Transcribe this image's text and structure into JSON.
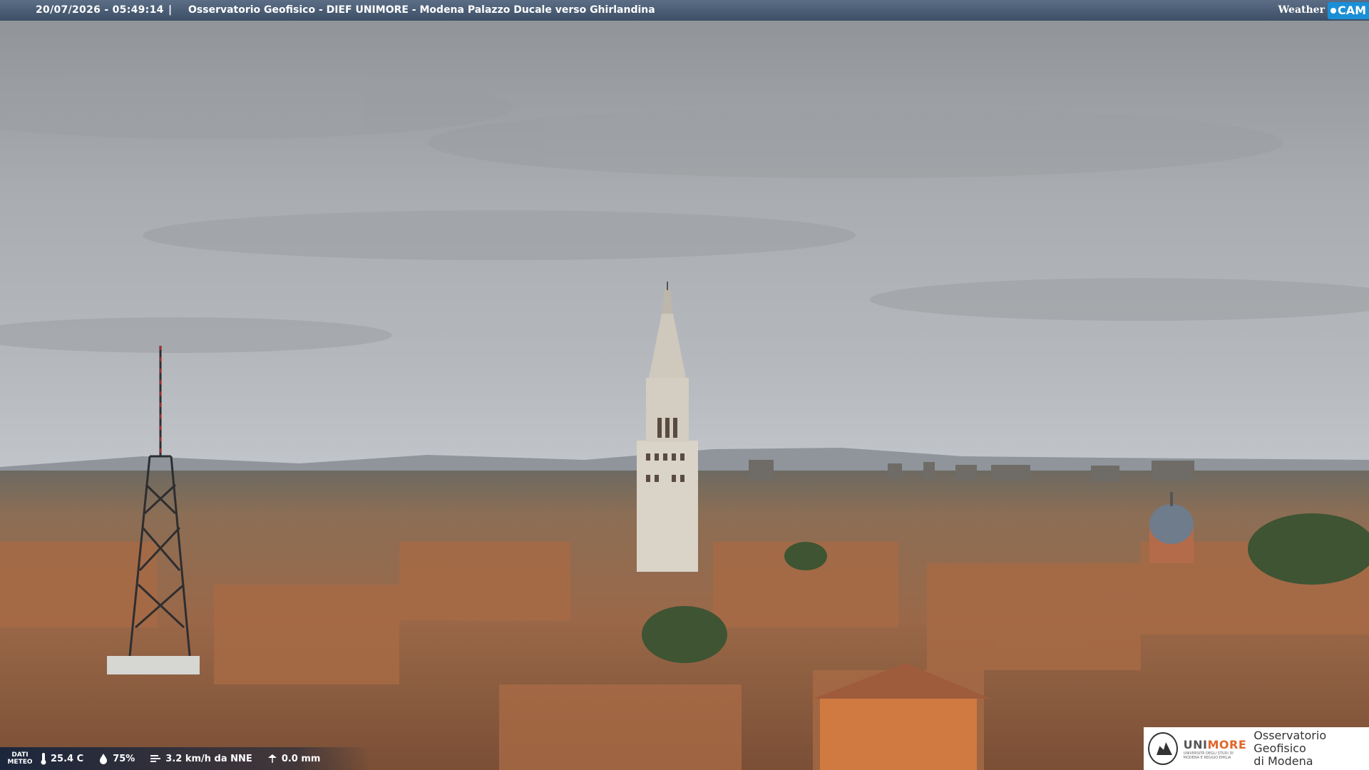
{
  "header": {
    "timestamp": "20/07/2026 - 05:49:14",
    "separator": "|",
    "title": "Osservatorio Geofisico - DIEF UNIMORE - Modena Palazzo Ducale verso Ghirlandina"
  },
  "brand": {
    "weather": "Weather",
    "cam": "CAM",
    "accent": "#1a8fd6"
  },
  "meteo": {
    "label_line1": "DATI",
    "label_line2": "METEO",
    "temperature": "25.4 C",
    "humidity": "75%",
    "wind": "3.2 km/h da NNE",
    "rain": "0.0 mm"
  },
  "logo": {
    "uni": "UNI",
    "more": "MORE",
    "subtitle_line1": "UNIVERSITÀ DEGLI STUDI DI",
    "subtitle_line2": "MODENA E REGGIO EMILIA",
    "observatory_line1": "Osservatorio Geofisico",
    "observatory_line2": "di Modena"
  }
}
